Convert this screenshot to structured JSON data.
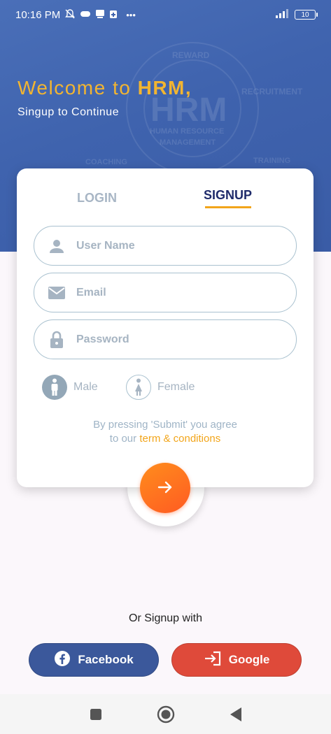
{
  "status_bar": {
    "time": "10:16 PM",
    "more": "•••",
    "battery": "10"
  },
  "hero": {
    "welcome_prefix": "Welcome to ",
    "welcome_brand": "HRM,",
    "subtitle": "Singup to Continue",
    "background_words": [
      "REWARD",
      "RECRUITMENT",
      "HRM",
      "HUMAN RESOURCE",
      "MANAGEMENT",
      "COACHING",
      "TRAINING"
    ]
  },
  "tabs": {
    "login": "LOGIN",
    "signup": "SIGNUP",
    "active": "signup"
  },
  "form": {
    "username_placeholder": "User Name",
    "email_placeholder": "Email",
    "password_placeholder": "Password",
    "username_value": "",
    "email_value": "",
    "password_value": ""
  },
  "gender": {
    "male": "Male",
    "female": "Female",
    "selected": "male"
  },
  "terms": {
    "line1": "By pressing 'Submit' you agree",
    "line2_prefix": "to our ",
    "link": "term & conditions"
  },
  "social": {
    "or_text": "Or Signup with",
    "facebook": "Facebook",
    "google": "Google"
  },
  "colors": {
    "accent": "#f2a51a",
    "hero": "#3f63ae",
    "navy": "#1f2b6b",
    "facebook": "#3b589b",
    "google": "#df4a3a",
    "submit": "#ff6a1f"
  },
  "icons": {
    "username": "person-icon",
    "email": "mail-icon",
    "password": "lock-icon",
    "male": "male-icon",
    "female": "female-icon",
    "submit": "arrow-right-icon",
    "facebook": "facebook-icon",
    "google": "login-icon"
  }
}
